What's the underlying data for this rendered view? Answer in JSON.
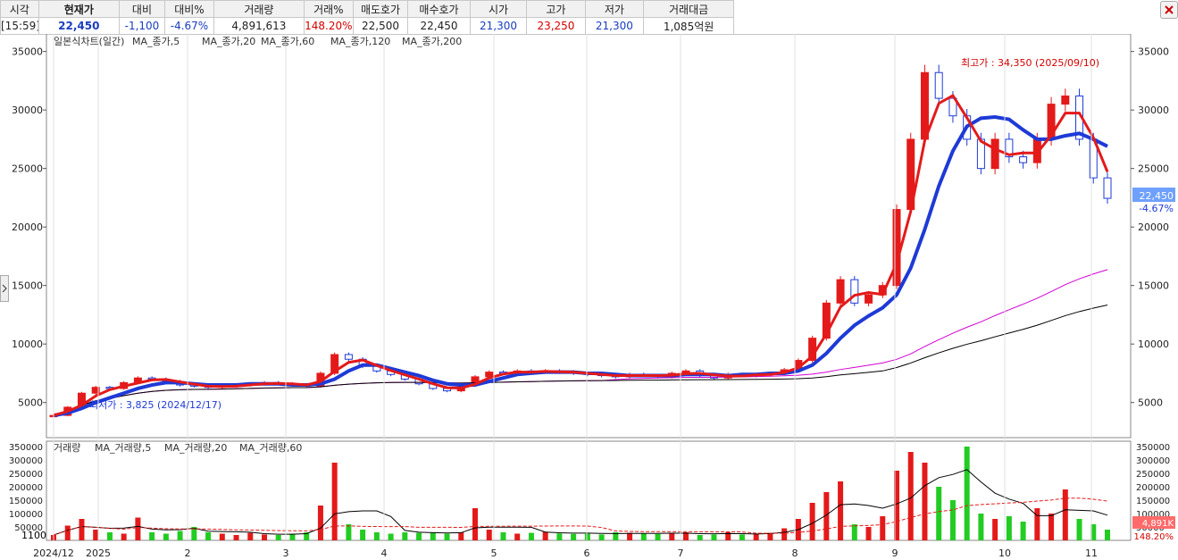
{
  "quote": {
    "headers": [
      "시각",
      "현재가",
      "대비",
      "대비%",
      "거래량",
      "거래%",
      "매도호가",
      "매수호가",
      "시가",
      "고가",
      "저가",
      "거래대금"
    ],
    "values": [
      "[15:59]",
      "22,450",
      "-1,100",
      "-4.67%",
      "4,891,613",
      "148.20%",
      "22,500",
      "22,450",
      "21,300",
      "23,250",
      "21,300",
      "1,085억원"
    ]
  },
  "colors": {
    "up": "#e41a1a",
    "down": "#1e3ad6",
    "ma5": "#e41a1a",
    "ma20": "#1e3ad6",
    "ma60": "#22cc22",
    "ma120": "#000000",
    "ma200": "#d200d2"
  },
  "chart_data": [
    {
      "type": "candlestick",
      "legend_title": "일본식차트(일간)",
      "legend": [
        {
          "name": "MA_종가,5",
          "color": "#e41a1a"
        },
        {
          "name": "MA_종가,20",
          "color": "#e41a1a"
        },
        {
          "name": "MA_종가,60",
          "color": "#1e3ad6"
        },
        {
          "name": "MA_종가,120",
          "color": "#22cc22"
        },
        {
          "name": "MA_종가,200",
          "color": "#000000"
        }
      ],
      "y_ticks": [
        5000,
        10000,
        15000,
        20000,
        25000,
        30000,
        35000
      ],
      "ylim": [
        2000,
        36500
      ],
      "x_ticks": [
        "2024/12",
        "2025",
        "2",
        "3",
        "4",
        "5",
        "6",
        "7",
        "8",
        "9",
        "10",
        "11"
      ],
      "annotations": {
        "high": "최고가 : 34,350 (2025/09/10)",
        "low": "최저가 : 3,825 (2024/12/17)"
      },
      "last_price": "22,450",
      "last_change": "-4.67%",
      "close": [
        3900,
        4600,
        5800,
        6300,
        6200,
        6700,
        7100,
        7000,
        6800,
        6500,
        6400,
        6300,
        6400,
        6500,
        6600,
        6700,
        6600,
        6500,
        6400,
        7500,
        9100,
        8700,
        8100,
        7700,
        7400,
        7000,
        6600,
        6200,
        6000,
        6500,
        7200,
        7600,
        7500,
        7700,
        7600,
        7700,
        7600,
        7500,
        7400,
        7300,
        7200,
        7400,
        7300,
        7200,
        7500,
        7700,
        7300,
        7100,
        7400,
        7300,
        7400,
        7500,
        7800,
        8600,
        10500,
        13500,
        15500,
        13500,
        14200,
        15000,
        21500,
        27500,
        33200,
        31000,
        29500,
        27500,
        25000,
        27500,
        26000,
        25500,
        27500,
        30500,
        31200,
        27500,
        24200,
        22450
      ],
      "ma20": [
        3900,
        4100,
        4500,
        5000,
        5400,
        5800,
        6200,
        6500,
        6700,
        6700,
        6600,
        6500,
        6500,
        6500,
        6600,
        6600,
        6600,
        6500,
        6500,
        6600,
        7000,
        7700,
        8200,
        8200,
        7900,
        7600,
        7300,
        6900,
        6600,
        6500,
        6500,
        6800,
        7100,
        7400,
        7500,
        7600,
        7600,
        7600,
        7500,
        7500,
        7400,
        7300,
        7300,
        7300,
        7300,
        7400,
        7400,
        7400,
        7300,
        7400,
        7400,
        7500,
        7500,
        7700,
        8200,
        9200,
        10500,
        11600,
        12400,
        13100,
        14200,
        16500,
        19800,
        23500,
        26500,
        28600,
        29300,
        29400,
        29200,
        28300,
        27500,
        27500,
        27800,
        28000,
        27500,
        26900
      ]
    },
    {
      "type": "bar",
      "legend": [
        {
          "name": "거래량",
          "color": "#e41a1a"
        },
        {
          "name": "MA_거래량,5",
          "color": "#000000"
        },
        {
          "name": "MA_거래량,20",
          "color": "#e41a1a"
        },
        {
          "name": "MA_거래량,60",
          "color": "#22cc22"
        }
      ],
      "y_ticks": [
        50000,
        100000,
        150000,
        200000,
        250000,
        300000,
        350000
      ],
      "y_tick_labels": [
        "50000",
        "100000",
        "150000",
        "200000",
        "250000",
        "300000",
        "350000"
      ],
      "left_marker": "1100",
      "ylim": [
        0,
        370000
      ],
      "last_volume": "4,891K",
      "last_pct": "148.20%",
      "volume": [
        20000,
        55000,
        80000,
        40000,
        30000,
        25000,
        85000,
        30000,
        25000,
        35000,
        50000,
        30000,
        25000,
        20000,
        28000,
        22000,
        20000,
        25000,
        30000,
        130000,
        290000,
        60000,
        40000,
        30000,
        25000,
        30000,
        28000,
        30000,
        25000,
        30000,
        120000,
        40000,
        30000,
        25000,
        28000,
        32000,
        26000,
        24000,
        25000,
        22000,
        30000,
        28000,
        25000,
        24000,
        26000,
        30000,
        20000,
        22000,
        30000,
        22000,
        25000,
        28000,
        45000,
        80000,
        140000,
        180000,
        220000,
        60000,
        50000,
        90000,
        260000,
        330000,
        290000,
        200000,
        150000,
        350000,
        100000,
        80000,
        90000,
        70000,
        120000,
        100000,
        190000,
        80000,
        60000,
        40000
      ]
    }
  ]
}
